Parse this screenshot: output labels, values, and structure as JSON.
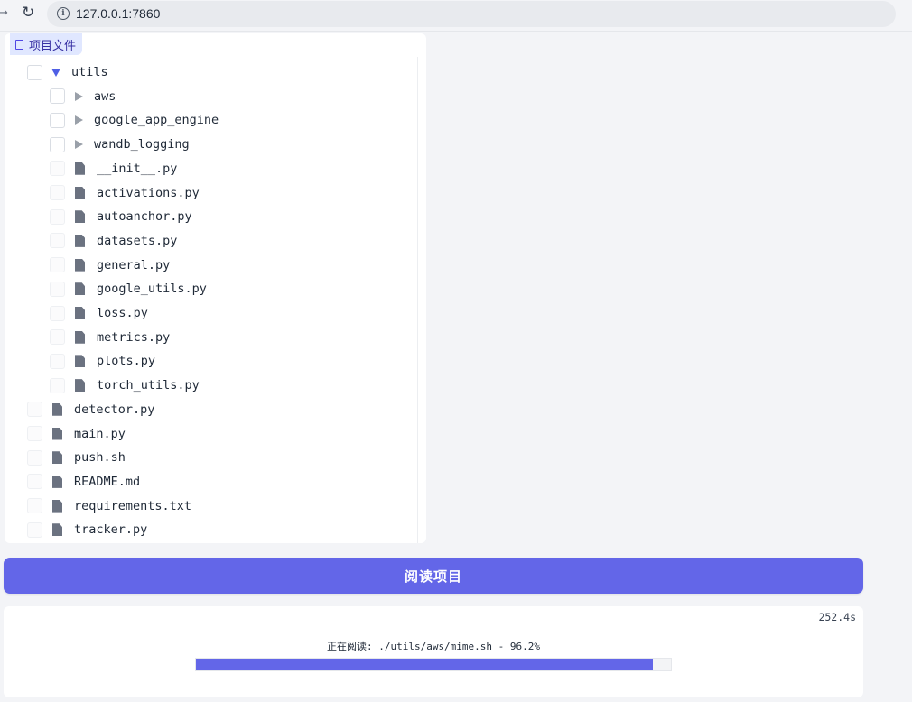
{
  "browser": {
    "url": "127.0.0.1:7860",
    "back_icon": "arrow-right-icon",
    "reload_icon": "reload-icon",
    "info_icon": "info-icon"
  },
  "panel": {
    "label": "项目文件",
    "label_icon": "document-icon"
  },
  "tree": [
    {
      "name": "utils",
      "type": "folder",
      "expanded": true,
      "depth": 0
    },
    {
      "name": "aws",
      "type": "folder",
      "expanded": false,
      "depth": 1
    },
    {
      "name": "google_app_engine",
      "type": "folder",
      "expanded": false,
      "depth": 1
    },
    {
      "name": "wandb_logging",
      "type": "folder",
      "expanded": false,
      "depth": 1
    },
    {
      "name": "__init__.py",
      "type": "file",
      "depth": 1
    },
    {
      "name": "activations.py",
      "type": "file",
      "depth": 1
    },
    {
      "name": "autoanchor.py",
      "type": "file",
      "depth": 1
    },
    {
      "name": "datasets.py",
      "type": "file",
      "depth": 1
    },
    {
      "name": "general.py",
      "type": "file",
      "depth": 1
    },
    {
      "name": "google_utils.py",
      "type": "file",
      "depth": 1
    },
    {
      "name": "loss.py",
      "type": "file",
      "depth": 1
    },
    {
      "name": "metrics.py",
      "type": "file",
      "depth": 1
    },
    {
      "name": "plots.py",
      "type": "file",
      "depth": 1
    },
    {
      "name": "torch_utils.py",
      "type": "file",
      "depth": 1
    },
    {
      "name": "detector.py",
      "type": "file",
      "depth": 0
    },
    {
      "name": "main.py",
      "type": "file",
      "depth": 0
    },
    {
      "name": "push.sh",
      "type": "file",
      "depth": 0
    },
    {
      "name": "README.md",
      "type": "file",
      "depth": 0
    },
    {
      "name": "requirements.txt",
      "type": "file",
      "depth": 0
    },
    {
      "name": "tracker.py",
      "type": "file",
      "depth": 0
    }
  ],
  "actions": {
    "read_label": "阅读项目"
  },
  "progress": {
    "elapsed": "252.4s",
    "text": "正在阅读: ./utils/aws/mime.sh - 96.2%",
    "fraction": 0.962
  },
  "colors": {
    "accent": "#6366e8",
    "panel_label_bg": "#e0e7ff",
    "page_bg": "#f3f4f7"
  }
}
